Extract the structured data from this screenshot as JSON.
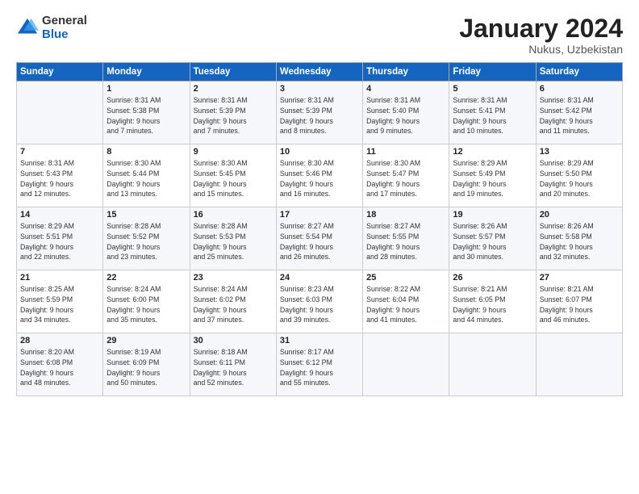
{
  "logo": {
    "general": "General",
    "blue": "Blue"
  },
  "title": "January 2024",
  "location": "Nukus, Uzbekistan",
  "days_header": [
    "Sunday",
    "Monday",
    "Tuesday",
    "Wednesday",
    "Thursday",
    "Friday",
    "Saturday"
  ],
  "weeks": [
    [
      {
        "num": "",
        "info": ""
      },
      {
        "num": "1",
        "info": "Sunrise: 8:31 AM\nSunset: 5:38 PM\nDaylight: 9 hours\nand 7 minutes."
      },
      {
        "num": "2",
        "info": "Sunrise: 8:31 AM\nSunset: 5:39 PM\nDaylight: 9 hours\nand 7 minutes."
      },
      {
        "num": "3",
        "info": "Sunrise: 8:31 AM\nSunset: 5:39 PM\nDaylight: 9 hours\nand 8 minutes."
      },
      {
        "num": "4",
        "info": "Sunrise: 8:31 AM\nSunset: 5:40 PM\nDaylight: 9 hours\nand 9 minutes."
      },
      {
        "num": "5",
        "info": "Sunrise: 8:31 AM\nSunset: 5:41 PM\nDaylight: 9 hours\nand 10 minutes."
      },
      {
        "num": "6",
        "info": "Sunrise: 8:31 AM\nSunset: 5:42 PM\nDaylight: 9 hours\nand 11 minutes."
      }
    ],
    [
      {
        "num": "7",
        "info": "Sunrise: 8:31 AM\nSunset: 5:43 PM\nDaylight: 9 hours\nand 12 minutes."
      },
      {
        "num": "8",
        "info": "Sunrise: 8:30 AM\nSunset: 5:44 PM\nDaylight: 9 hours\nand 13 minutes."
      },
      {
        "num": "9",
        "info": "Sunrise: 8:30 AM\nSunset: 5:45 PM\nDaylight: 9 hours\nand 15 minutes."
      },
      {
        "num": "10",
        "info": "Sunrise: 8:30 AM\nSunset: 5:46 PM\nDaylight: 9 hours\nand 16 minutes."
      },
      {
        "num": "11",
        "info": "Sunrise: 8:30 AM\nSunset: 5:47 PM\nDaylight: 9 hours\nand 17 minutes."
      },
      {
        "num": "12",
        "info": "Sunrise: 8:29 AM\nSunset: 5:49 PM\nDaylight: 9 hours\nand 19 minutes."
      },
      {
        "num": "13",
        "info": "Sunrise: 8:29 AM\nSunset: 5:50 PM\nDaylight: 9 hours\nand 20 minutes."
      }
    ],
    [
      {
        "num": "14",
        "info": "Sunrise: 8:29 AM\nSunset: 5:51 PM\nDaylight: 9 hours\nand 22 minutes."
      },
      {
        "num": "15",
        "info": "Sunrise: 8:28 AM\nSunset: 5:52 PM\nDaylight: 9 hours\nand 23 minutes."
      },
      {
        "num": "16",
        "info": "Sunrise: 8:28 AM\nSunset: 5:53 PM\nDaylight: 9 hours\nand 25 minutes."
      },
      {
        "num": "17",
        "info": "Sunrise: 8:27 AM\nSunset: 5:54 PM\nDaylight: 9 hours\nand 26 minutes."
      },
      {
        "num": "18",
        "info": "Sunrise: 8:27 AM\nSunset: 5:55 PM\nDaylight: 9 hours\nand 28 minutes."
      },
      {
        "num": "19",
        "info": "Sunrise: 8:26 AM\nSunset: 5:57 PM\nDaylight: 9 hours\nand 30 minutes."
      },
      {
        "num": "20",
        "info": "Sunrise: 8:26 AM\nSunset: 5:58 PM\nDaylight: 9 hours\nand 32 minutes."
      }
    ],
    [
      {
        "num": "21",
        "info": "Sunrise: 8:25 AM\nSunset: 5:59 PM\nDaylight: 9 hours\nand 34 minutes."
      },
      {
        "num": "22",
        "info": "Sunrise: 8:24 AM\nSunset: 6:00 PM\nDaylight: 9 hours\nand 35 minutes."
      },
      {
        "num": "23",
        "info": "Sunrise: 8:24 AM\nSunset: 6:02 PM\nDaylight: 9 hours\nand 37 minutes."
      },
      {
        "num": "24",
        "info": "Sunrise: 8:23 AM\nSunset: 6:03 PM\nDaylight: 9 hours\nand 39 minutes."
      },
      {
        "num": "25",
        "info": "Sunrise: 8:22 AM\nSunset: 6:04 PM\nDaylight: 9 hours\nand 41 minutes."
      },
      {
        "num": "26",
        "info": "Sunrise: 8:21 AM\nSunset: 6:05 PM\nDaylight: 9 hours\nand 44 minutes."
      },
      {
        "num": "27",
        "info": "Sunrise: 8:21 AM\nSunset: 6:07 PM\nDaylight: 9 hours\nand 46 minutes."
      }
    ],
    [
      {
        "num": "28",
        "info": "Sunrise: 8:20 AM\nSunset: 6:08 PM\nDaylight: 9 hours\nand 48 minutes."
      },
      {
        "num": "29",
        "info": "Sunrise: 8:19 AM\nSunset: 6:09 PM\nDaylight: 9 hours\nand 50 minutes."
      },
      {
        "num": "30",
        "info": "Sunrise: 8:18 AM\nSunset: 6:11 PM\nDaylight: 9 hours\nand 52 minutes."
      },
      {
        "num": "31",
        "info": "Sunrise: 8:17 AM\nSunset: 6:12 PM\nDaylight: 9 hours\nand 55 minutes."
      },
      {
        "num": "",
        "info": ""
      },
      {
        "num": "",
        "info": ""
      },
      {
        "num": "",
        "info": ""
      }
    ]
  ]
}
